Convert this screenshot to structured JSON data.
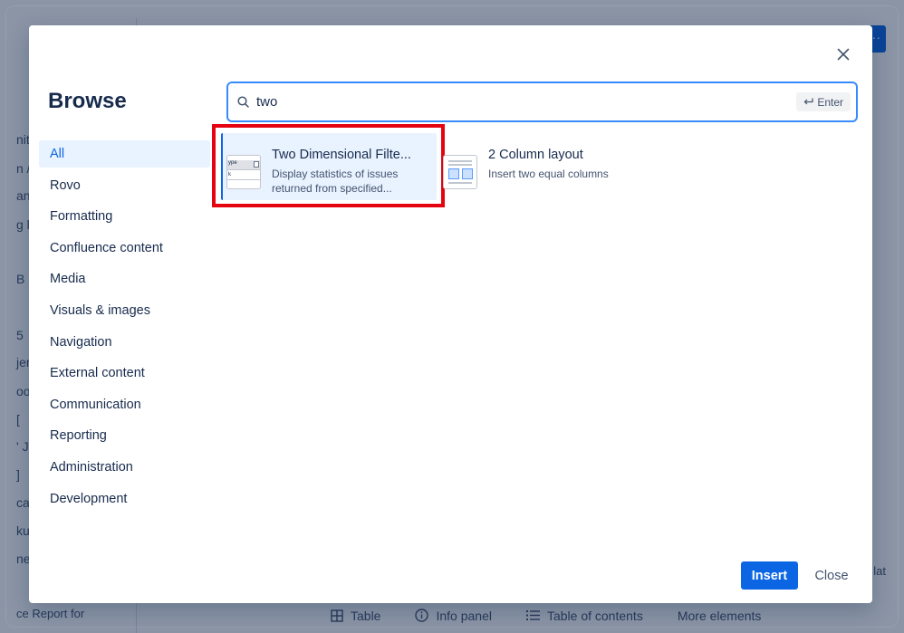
{
  "background": {
    "side_fragments": [
      "nit",
      "n /",
      "an",
      "g l",
      "B",
      "5",
      "jer",
      "oo",
      "[",
      "' J",
      "]",
      "ca",
      "ku",
      "ne"
    ],
    "bottom_left": "ce Report for",
    "right_edge": "lat",
    "toolbar": {
      "table_label": "Table",
      "info_panel_label": "Info panel",
      "toc_label": "Table of contents",
      "more_label": "More elements"
    }
  },
  "modal": {
    "title": "Browse",
    "search": {
      "value": "two",
      "enter_hint": "Enter"
    },
    "categories": [
      {
        "label": "All"
      },
      {
        "label": "Rovo"
      },
      {
        "label": "Formatting"
      },
      {
        "label": "Confluence content"
      },
      {
        "label": "Media"
      },
      {
        "label": "Visuals & images"
      },
      {
        "label": "Navigation"
      },
      {
        "label": "External content"
      },
      {
        "label": "Communication"
      },
      {
        "label": "Reporting"
      },
      {
        "label": "Administration"
      },
      {
        "label": "Development"
      }
    ],
    "results": [
      {
        "title": "Two Dimensional Filte...",
        "description": "Display statistics of issues returned from specified...",
        "thumb_text_1": "ype",
        "thumb_text_2": "k"
      },
      {
        "title": "2 Column layout",
        "description": "Insert two equal columns"
      }
    ],
    "footer": {
      "insert_label": "Insert",
      "close_label": "Close"
    }
  },
  "colors": {
    "primary": "#0c66e4",
    "selected_bg": "#e9f2ff",
    "highlight_outline": "#e5030f",
    "focus_border": "#388bff"
  }
}
